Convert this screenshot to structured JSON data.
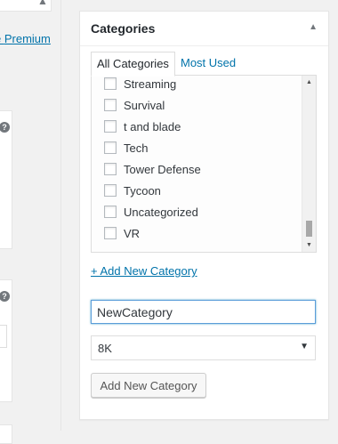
{
  "left_panel": {
    "premium_link": "Premium",
    "help_icon": "?"
  },
  "categories_box": {
    "title": "Categories",
    "toggle_icon": "collapse-up-icon",
    "tabs": [
      {
        "label": "All Categories",
        "active": true
      },
      {
        "label": "Most Used",
        "active": false
      }
    ],
    "items": [
      {
        "label": "Streaming",
        "checked": false
      },
      {
        "label": "Survival",
        "checked": false
      },
      {
        "label": "t and blade",
        "checked": false
      },
      {
        "label": "Tech",
        "checked": false
      },
      {
        "label": "Tower Defense",
        "checked": false
      },
      {
        "label": "Tycoon",
        "checked": false
      },
      {
        "label": "Uncategorized",
        "checked": false
      },
      {
        "label": "VR",
        "checked": false
      }
    ],
    "add_new_link": "+ Add New Category",
    "new_category_value": "NewCategory",
    "parent_select_value": "8K",
    "add_button_label": "Add New Category"
  },
  "colors": {
    "link": "#0073aa",
    "focus_border": "#5b9dd9",
    "background": "#f1f1f1"
  }
}
